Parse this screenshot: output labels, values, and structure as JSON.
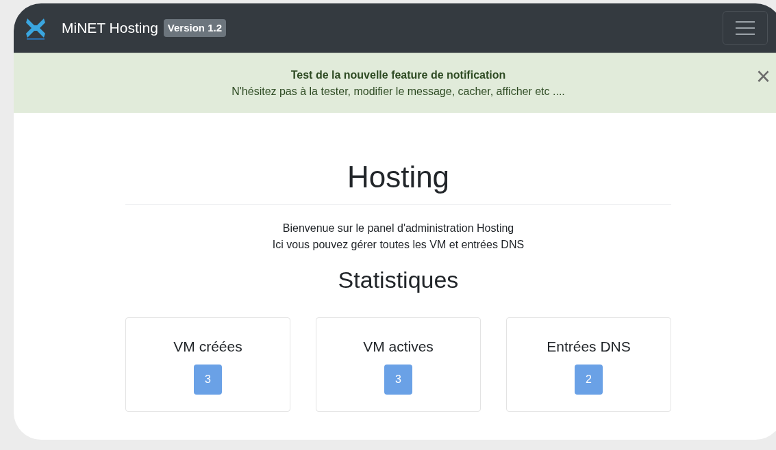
{
  "navbar": {
    "brand": "MiNET Hosting",
    "version_badge": "Version 1.2"
  },
  "notification": {
    "title": "Test de la nouvelle feature de notification",
    "message": "N'hésitez pas à la tester, modifier le message, cacher, afficher etc ....",
    "close": "×"
  },
  "heading": "Hosting",
  "intro": [
    "Bienvenue sur le panel d'administration Hosting",
    "Ici vous pouvez gérer toutes les VM et entrées DNS"
  ],
  "stats_heading": "Statistiques",
  "stats": [
    {
      "label": "VM créées",
      "value": "3"
    },
    {
      "label": "VM actives",
      "value": "3"
    },
    {
      "label": "Entrées DNS",
      "value": "2"
    }
  ]
}
